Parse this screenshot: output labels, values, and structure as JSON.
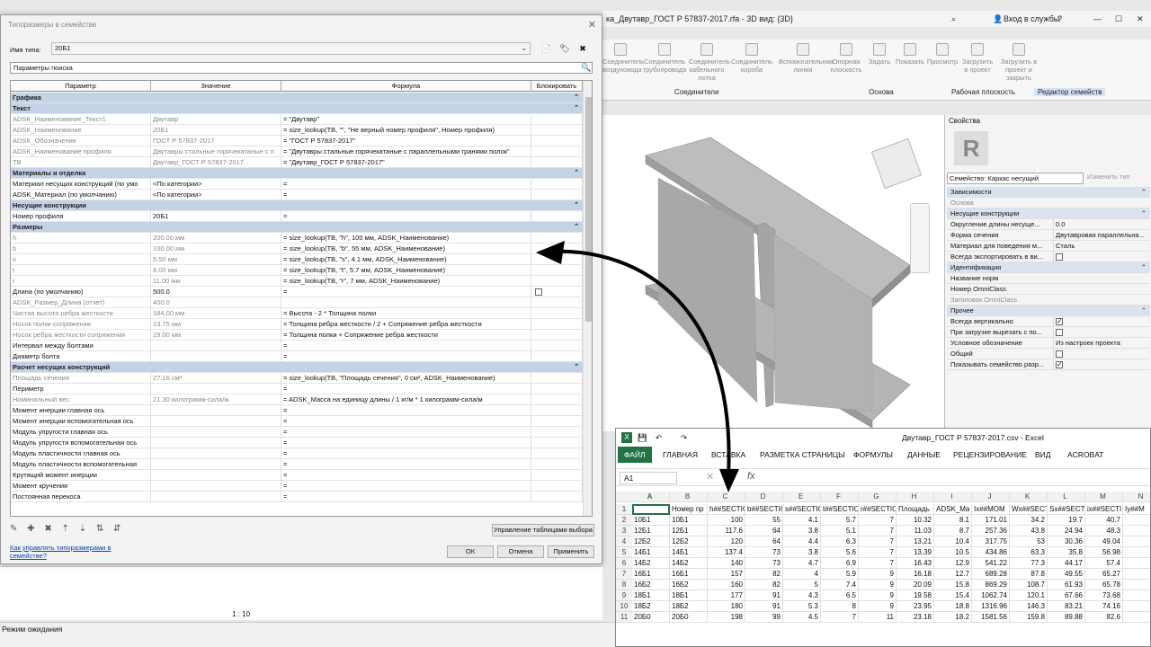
{
  "revit": {
    "title": "ка_Двутавр_ГОСТ Р 57837-2017.rfa - 3D вид: {3D}",
    "signin": "Вход в службы",
    "ribbon_items": [
      "Соединитель воздуховода",
      "Соединитель трубопровода",
      "Соединитель кабельного лотка",
      "Соединитель короба",
      "Вспомогательная линия",
      "Опорная плоскость",
      "Задать",
      "Показать",
      "Просмотр",
      "Загрузить в проект",
      "Загрузить в проект и закрыть"
    ],
    "ribbon_groups": [
      "Соединители",
      "Основа",
      "Рабочая плоскость",
      "Редактор семейств"
    ],
    "scale": "1 : 10",
    "status": "Режим ожидания"
  },
  "props": {
    "title": "Свойства",
    "family": "Семейство: Каркас несущий",
    "edit_type": "Изменить тип",
    "rows": [
      {
        "k": "Зависимости",
        "v": "",
        "sec": true
      },
      {
        "k": "Основа",
        "v": "",
        "gray": true
      },
      {
        "k": "Несущие конструкции",
        "v": "",
        "sec": true
      },
      {
        "k": "Округление длины несуще...",
        "v": "0.0"
      },
      {
        "k": "Форма сечения",
        "v": "Двутавровая параллельна..."
      },
      {
        "k": "Материал для поведения м...",
        "v": "Сталь"
      },
      {
        "k": "Всегда экспортировать в ви...",
        "v": "",
        "cb": "off"
      },
      {
        "k": "Идентификация",
        "v": "",
        "sec": true
      },
      {
        "k": "Название норм",
        "v": ""
      },
      {
        "k": "Номер OmniClass",
        "v": ""
      },
      {
        "k": "Заголовок OmniClass",
        "v": "",
        "gray": true
      },
      {
        "k": "Прочее",
        "v": "",
        "sec": true
      },
      {
        "k": "Всегда вертикально",
        "v": "",
        "cb": "on"
      },
      {
        "k": "При загрузке вырезать с по...",
        "v": "",
        "cb": "off"
      },
      {
        "k": "Условное обозначение",
        "v": "Из настроек проекта"
      },
      {
        "k": "Общий",
        "v": "",
        "cb": "off"
      },
      {
        "k": "Показывать семейство разр...",
        "v": "",
        "cb": "on"
      }
    ]
  },
  "dialog": {
    "title": "Типоразмеры в семействе",
    "type_label": "Имя типа:",
    "type_value": "20Б1",
    "search_placeholder": "Параметры поиска",
    "headers": [
      "Параметр",
      "Значение",
      "Формула",
      "Блокировать"
    ],
    "rows": [
      {
        "g": "Графика"
      },
      {
        "g": "Текст"
      },
      {
        "p": "ADSK_Наименование_Текст1",
        "v": "Двутавр",
        "f": "= \"Двутавр\"",
        "gray": true
      },
      {
        "p": "ADSK_Наименование",
        "v": "20Б1",
        "f": "= size_lookup(ТВ, \"\", \"Не верный номер профиля\", Номер профиля)",
        "gray": true
      },
      {
        "p": "ADSK_Обозначение",
        "v": "ГОСТ Р 57837-2017",
        "f": "= \"ГОСТ Р 57837-2017\"",
        "gray": true
      },
      {
        "p": "ADSK_Наименование профиля",
        "v": "Двутавры стальные горячекатаные с п",
        "f": "= \"Двутавры стальные горячекатаные с параллельными гранями полок\"",
        "gray": true
      },
      {
        "p": "ТВ",
        "v": "Двутавр_ГОСТ Р 57837-2017",
        "f": "= \"Двутавр_ГОСТ Р 57837-2017\"",
        "gray": true
      },
      {
        "g": "Материалы и отделка"
      },
      {
        "p": "Материал несущих конструкций (по умо",
        "v": "<По категории>",
        "f": "="
      },
      {
        "p": "ADSK_Материал (по умолчанию)",
        "v": "<По категории>",
        "f": "="
      },
      {
        "g": "Несущие конструкции"
      },
      {
        "p": "Номер профиля",
        "v": "20Б1",
        "f": "="
      },
      {
        "g": "Размеры"
      },
      {
        "p": "h",
        "v": "200.00 мм",
        "f": "= size_lookup(ТВ, \"h\", 100 мм, ADSK_Наименование)",
        "gray": true
      },
      {
        "p": "b",
        "v": "100.00 мм",
        "f": "= size_lookup(ТВ, \"b\", 55 мм, ADSK_Наименование)",
        "gray": true
      },
      {
        "p": "s",
        "v": "5.50 мм",
        "f": "= size_lookup(ТВ, \"s\", 4.1 мм, ADSK_Наименование)",
        "gray": true
      },
      {
        "p": "t",
        "v": "8.00 мм",
        "f": "= size_lookup(ТВ, \"t\", 5.7 мм, ADSK_Наименование)",
        "gray": true
      },
      {
        "p": "r",
        "v": "11.00 мм",
        "f": "= size_lookup(ТВ, \"r\", 7 мм, ADSK_Наименование)",
        "gray": true
      },
      {
        "p": "Длина (по умолчанию)",
        "v": "500.0",
        "f": "=",
        "lock": true
      },
      {
        "p": "ADSK_Размер_Длина (отчет)",
        "v": "400.0",
        "f": "",
        "gray": true
      },
      {
        "p": "Чистая высота ребра жесткости",
        "v": "184.00 мм",
        "f": "= Высота - 2 * Толщина полки",
        "gray": true
      },
      {
        "p": "Носок полки сопряжения",
        "v": "13.75 мм",
        "f": "= Толщина ребра жесткости / 2 + Сопряжение ребра жесткости",
        "gray": true
      },
      {
        "p": "Носок ребра жесткости сопряжения",
        "v": "19.00 мм",
        "f": "= Толщина полки + Сопряжение ребра жесткости",
        "gray": true
      },
      {
        "p": "Интервал между болтами",
        "v": "",
        "f": "="
      },
      {
        "p": "Диаметр болта",
        "v": "",
        "f": "="
      },
      {
        "g": "Расчет несущих конструкций"
      },
      {
        "p": "Площадь сечения",
        "v": "27.16 см²",
        "f": "= size_lookup(ТВ, \"Площадь сечения\", 0 см², ADSK_Наименование)",
        "gray": true
      },
      {
        "p": "Периметр",
        "v": "",
        "f": "="
      },
      {
        "p": "Номинальный вес",
        "v": "21.30 килограмм-сила/м",
        "f": "= ADSK_Масса на единицу длины / 1 кг/м * 1 килограмм-сила/м",
        "gray": true
      },
      {
        "p": "Момент инерции главная ось",
        "v": "",
        "f": "="
      },
      {
        "p": "Момент инерции вспомогательная ось",
        "v": "",
        "f": "="
      },
      {
        "p": "Модуль упругости главная ось",
        "v": "",
        "f": "="
      },
      {
        "p": "Модуль упругости вспомогательная ось",
        "v": "",
        "f": "="
      },
      {
        "p": "Модуль пластичности главная ось",
        "v": "",
        "f": "="
      },
      {
        "p": "Модуль пластичности вспомогательная",
        "v": "",
        "f": "="
      },
      {
        "p": "Крутящий момент инерции",
        "v": "",
        "f": "="
      },
      {
        "p": "Момент кручения",
        "v": "",
        "f": "="
      },
      {
        "p": "Постоянная перекоса",
        "v": "",
        "f": "="
      }
    ],
    "manage_btn": "Управление таблицами выбора",
    "help_link": "Как управлять типоразмерами в семействе?",
    "ok": "ОК",
    "cancel": "Отмена",
    "apply": "Применить"
  },
  "excel": {
    "title": "Двутавр_ГОСТ Р 57837-2017.csv - Excel",
    "tabs": [
      "ФАЙЛ",
      "ГЛАВНАЯ",
      "ВСТАВКА",
      "РАЗМЕТКА СТРАНИЦЫ",
      "ФОРМУЛЫ",
      "ДАННЫЕ",
      "РЕЦЕНЗИРОВАНИЕ",
      "ВИД",
      "ACROBAT"
    ],
    "namebox": "A1",
    "cols": [
      "A",
      "B",
      "C",
      "D",
      "E",
      "F",
      "G",
      "H",
      "I",
      "J",
      "K",
      "L",
      "M",
      "N"
    ],
    "rows": [
      [
        "",
        "Номер пр",
        "h##SECTIO",
        "b##SECTIO",
        "s##SECTIO",
        "t##SECTIO",
        "r##SECTIO",
        "Площадь",
        "ADSK_Ma",
        "Ix##MOM",
        "Wx##SECT",
        "Sx##SECT",
        "ix##SECTI",
        "Iy##M"
      ],
      [
        "10Б1",
        "10Б1",
        "100",
        "55",
        "4.1",
        "5.7",
        "7",
        "10.32",
        "8.1",
        "171.01",
        "34.2",
        "19.7",
        "40.7",
        ""
      ],
      [
        "12Б1",
        "12Б1",
        "117.6",
        "64",
        "3.8",
        "5.1",
        "7",
        "11.03",
        "8.7",
        "257.36",
        "43.8",
        "24.94",
        "48.3",
        ""
      ],
      [
        "12Б2",
        "12Б2",
        "120",
        "64",
        "4.4",
        "6.3",
        "7",
        "13.21",
        "10.4",
        "317.75",
        "53",
        "30.36",
        "49.04",
        ""
      ],
      [
        "14Б1",
        "14Б1",
        "137.4",
        "73",
        "3.8",
        "5.6",
        "7",
        "13.39",
        "10.5",
        "434.86",
        "63.3",
        "35.8",
        "56.98",
        ""
      ],
      [
        "14Б2",
        "14Б2",
        "140",
        "73",
        "4.7",
        "6.9",
        "7",
        "16.43",
        "12.9",
        "541.22",
        "77.3",
        "44.17",
        "57.4",
        ""
      ],
      [
        "16Б1",
        "16Б1",
        "157",
        "82",
        "4",
        "5.9",
        "9",
        "16.18",
        "12.7",
        "689.28",
        "87.8",
        "49.55",
        "65.27",
        ""
      ],
      [
        "16Б2",
        "16Б2",
        "160",
        "82",
        "5",
        "7.4",
        "9",
        "20.09",
        "15.8",
        "869.29",
        "108.7",
        "61.93",
        "65.78",
        ""
      ],
      [
        "18Б1",
        "18Б1",
        "177",
        "91",
        "4.3",
        "6.5",
        "9",
        "19.58",
        "15.4",
        "1062.74",
        "120.1",
        "67.66",
        "73.68",
        ""
      ],
      [
        "18Б2",
        "18Б2",
        "180",
        "91",
        "5.3",
        "8",
        "9",
        "23.95",
        "18.8",
        "1316.96",
        "146.3",
        "83.21",
        "74.16",
        ""
      ],
      [
        "20Б0",
        "20Б0",
        "198",
        "99",
        "4.5",
        "7",
        "11",
        "23.18",
        "18.2",
        "1581.56",
        "159.8",
        "89.88",
        "82.6",
        ""
      ]
    ]
  }
}
